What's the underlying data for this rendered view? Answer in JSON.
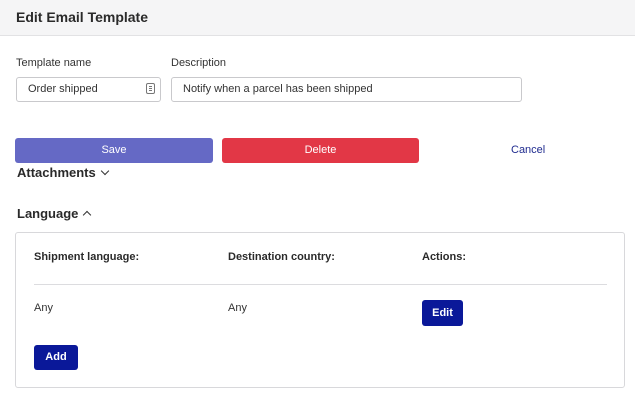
{
  "header": {
    "title": "Edit Email Template"
  },
  "form": {
    "template_name": {
      "label": "Template name",
      "value": "Order shipped"
    },
    "description": {
      "label": "Description",
      "value": "Notify when a parcel has been shipped"
    }
  },
  "actions": {
    "save_label": "Save",
    "delete_label": "Delete",
    "cancel_label": "Cancel"
  },
  "attachments": {
    "label": "Attachments",
    "expanded": false
  },
  "language": {
    "label": "Language",
    "expanded": true,
    "columns": [
      "Shipment language:",
      "Destination country:",
      "Actions:"
    ],
    "rows": [
      {
        "shipment_language": "Any",
        "destination_country": "Any",
        "action_label": "Edit"
      }
    ],
    "add_label": "Add"
  },
  "colors": {
    "save_button": "#6569c5",
    "delete_button": "#e23746",
    "primary_dark": "#0a1899",
    "link": "#1f2b8f"
  },
  "icons": {
    "template_name_field": "keyboard-icon",
    "attachments_toggle": "chevron-down-icon",
    "language_toggle": "chevron-up-icon"
  }
}
